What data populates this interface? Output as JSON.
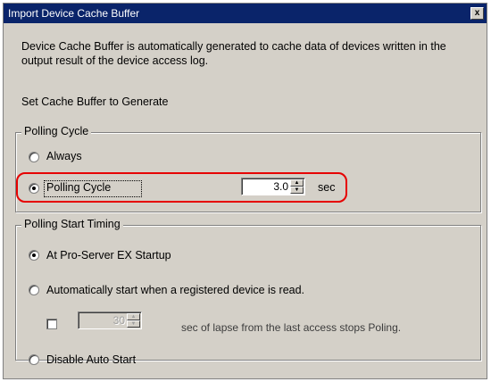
{
  "dialog": {
    "title": "Import Device Cache Buffer",
    "close_glyph": "x",
    "description": "Device Cache Buffer is automatically generated to cache data of devices written in the output result of the device access log.",
    "section_label": "Set Cache Buffer to Generate"
  },
  "polling_cycle_group": {
    "legend": "Polling Cycle",
    "option_always": "Always",
    "option_polling_cycle": "Polling Cycle",
    "selected": "Polling Cycle",
    "cycle_value": "3.0",
    "unit": "sec"
  },
  "polling_start_group": {
    "legend": "Polling Start Timing",
    "option_startup": "At Pro-Server EX Startup",
    "option_auto_start": "Automatically start when a registered device is read.",
    "lapse_value": "30",
    "lapse_suffix": "sec of lapse from the last access stops Poling.",
    "option_disable": "Disable Auto Start",
    "selected": "At Pro-Server EX Startup"
  },
  "colors": {
    "titlebar": "#0a246a",
    "dialog_face": "#d4d0c8",
    "highlight": "#e60000"
  }
}
